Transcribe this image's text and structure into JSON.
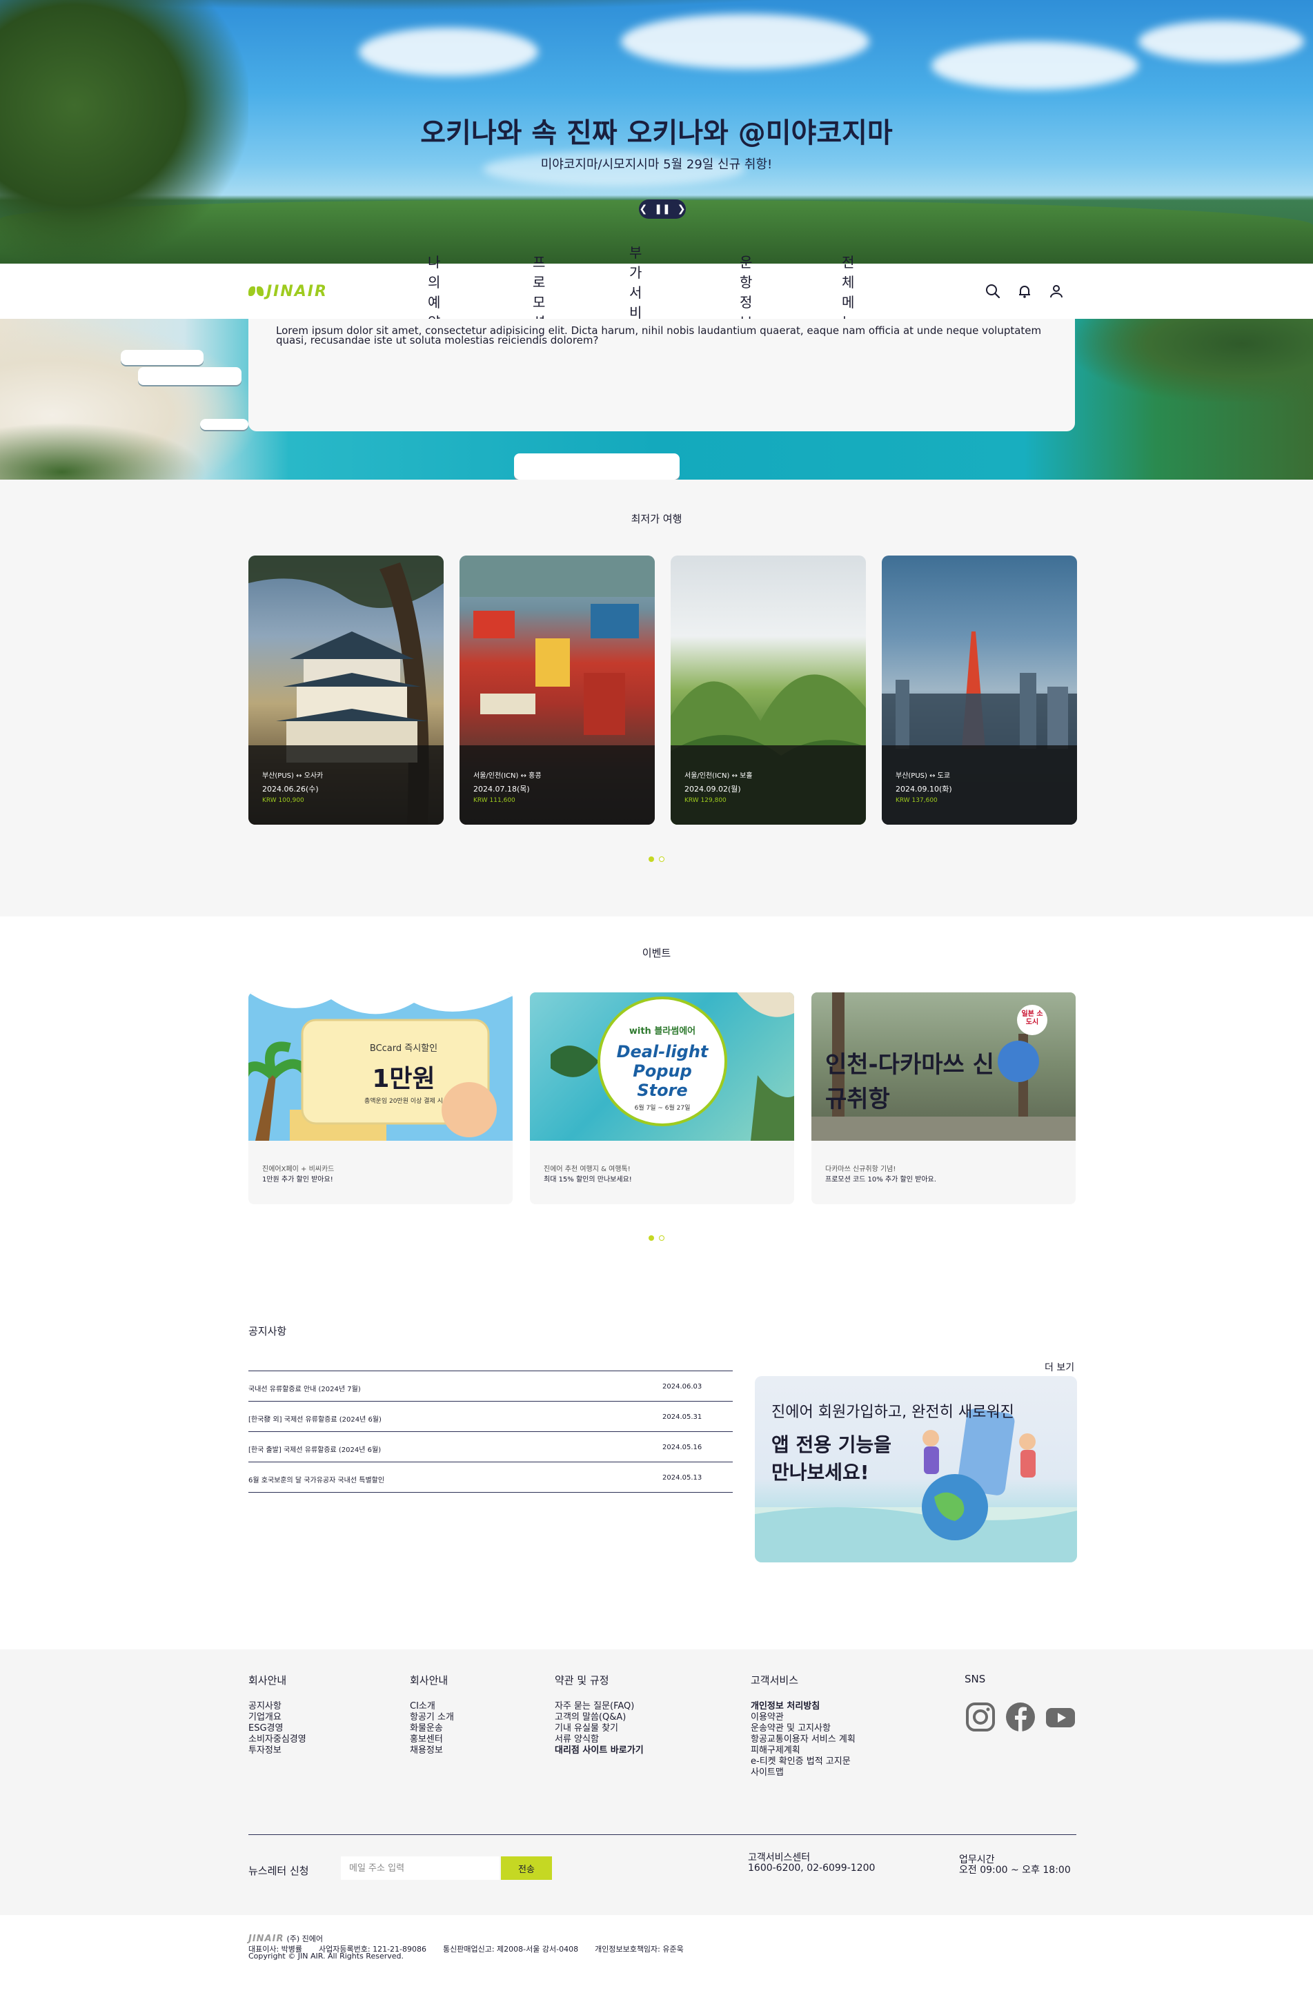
{
  "hero": {
    "title": "오키나와 속 진짜 오키나와 @미야코지마",
    "subtitle": "미야코지마/시모지시마 5월 29일 신규 취항!",
    "prev_icon": "chevron-left-icon",
    "pause_icon": "pause-icon",
    "next_icon": "chevron-right-icon"
  },
  "nav": {
    "logo": "JINAIR",
    "menu": [
      "나의예약",
      "프로모션",
      "부가서비스",
      "운항정보",
      "전체메뉴"
    ],
    "icons": [
      "search-icon",
      "bell-icon",
      "user-icon"
    ]
  },
  "info_card": {
    "text": "Lorem ipsum dolor sit amet, consectetur adipisicing elit. Dicta harum, nihil nobis laudantium quaerat, eaque nam officia at unde neque voluptatem quasi, recusandae iste ut soluta molestias reiciendis dolorem?"
  },
  "fares": {
    "title": "최저가 여행",
    "cards": [
      {
        "route": "부산(PUS) ↔ 오사카",
        "date": "2024.06.26(수)",
        "price": "KRW 100,900"
      },
      {
        "route": "서울/인천(ICN) ↔ 홍콩",
        "date": "2024.07.18(목)",
        "price": "KRW 111,600"
      },
      {
        "route": "서울/인천(ICN) ↔ 보홀",
        "date": "2024.09.02(월)",
        "price": "KRW 129,800"
      },
      {
        "route": "부산(PUS) ↔ 도쿄",
        "date": "2024.09.10(화)",
        "price": "KRW 137,600"
      }
    ],
    "pagination": {
      "current": 1,
      "total": 2
    }
  },
  "events": {
    "title": "이벤트",
    "items": [
      {
        "banner_brand": "BCcard 즉시할인",
        "banner_main": "1만원",
        "banner_note": "총액운임 20만원 이상 결제 시",
        "line1": "진에어X페이 + 비씨카드",
        "line2": "1만원 추가 할인 받아요!"
      },
      {
        "banner_brand": "with 블라썸에어",
        "banner_main": "Deal-light Popup Store",
        "banner_note": "6월 7일 ~ 6월 27일",
        "line1": "진에어 추천 여행지 & 여행톡!",
        "line2": "최대 15% 할인의 만나보세요!"
      },
      {
        "banner_brand": "일본 소도시",
        "banner_main": "인천-다카마쓰 신규취항",
        "banner_note": "",
        "line1": "다카마쓰 신규취항 기념!",
        "line2": "프로모션 코드 10% 추가 할인 받아요."
      }
    ],
    "pagination": {
      "current": 1,
      "total": 2
    }
  },
  "notice": {
    "title": "공지사항",
    "more": "더 보기",
    "rows": [
      {
        "title": "국내선 유류할증료 안내 (2024년 7월)",
        "date": "2024.06.03"
      },
      {
        "title": "[한국發 외] 국제선 유류할증료 (2024년 6월)",
        "date": "2024.05.31"
      },
      {
        "title": "[한국 출발] 국제선 유류할증료 (2024년 6월)",
        "date": "2024.05.16"
      },
      {
        "title": "6월 호국보훈의 달 국가유공자 국내선 특별할인",
        "date": "2024.05.13"
      }
    ]
  },
  "promo": {
    "line1": "진에어 회원가입하고, 완전히 새로워진",
    "line2a": "앱 전용 기능을",
    "line2b": "만나보세요!"
  },
  "footer": {
    "columns": [
      {
        "title": "회사안내",
        "links": [
          {
            "t": "공지사항"
          },
          {
            "t": "기업개요"
          },
          {
            "t": "ESG경영"
          },
          {
            "t": "소비자중심경영"
          },
          {
            "t": "투자정보"
          }
        ]
      },
      {
        "title": "회사안내",
        "links": [
          {
            "t": "CI소개"
          },
          {
            "t": "항공기 소개"
          },
          {
            "t": "화물운송"
          },
          {
            "t": "홍보센터"
          },
          {
            "t": "채용정보"
          }
        ]
      },
      {
        "title": "약관 및 규정",
        "links": [
          {
            "t": "자주 묻는 질문(FAQ)"
          },
          {
            "t": "고객의 말씀(Q&A)"
          },
          {
            "t": "기내 유실물 찾기"
          },
          {
            "t": "서류 양식함"
          },
          {
            "t": "대리점 사이트 바로가기",
            "bold": true
          }
        ]
      },
      {
        "title": "고객서비스",
        "links": [
          {
            "t": "개인정보 처리방침",
            "bold": true
          },
          {
            "t": "이용약관"
          },
          {
            "t": "운송약관 및 고지사항"
          },
          {
            "t": "항공교통이용자 서비스 계획"
          },
          {
            "t": "피해구제계획"
          },
          {
            "t": "e-티켓 확인증 법적 고지문"
          },
          {
            "t": "사이트맵"
          }
        ]
      }
    ],
    "sns_title": "SNS",
    "sns": [
      "instagram-icon",
      "facebook-icon",
      "youtube-icon"
    ],
    "newsletter_label": "뉴스레터 신청",
    "newsletter_placeholder": "메일 주소 입력",
    "newsletter_button": "전송",
    "cs_label": "고객서비스센터",
    "cs_value": "1600-6200, 02-6099-1200",
    "hours_label": "업무시간",
    "hours_value": "오전 09:00 ~ 오후 18:00"
  },
  "bottom": {
    "logo": "JINAIR",
    "company": "(주) 진에어",
    "ceo": "대표이사: 박병률",
    "biz_no": "사업자등록번호: 121-21-89086",
    "mail_order": "통신판매업신고: 제2008-서울 강서-0408",
    "privacy_officer": "개인정보보호책임자: 유준욱",
    "copyright": "Copyright © JIN AIR. All Rights Reserved."
  },
  "colors": {
    "brand_green": "#9ecb1f",
    "dot_active": "#c5d823",
    "navy": "#1f2548"
  }
}
